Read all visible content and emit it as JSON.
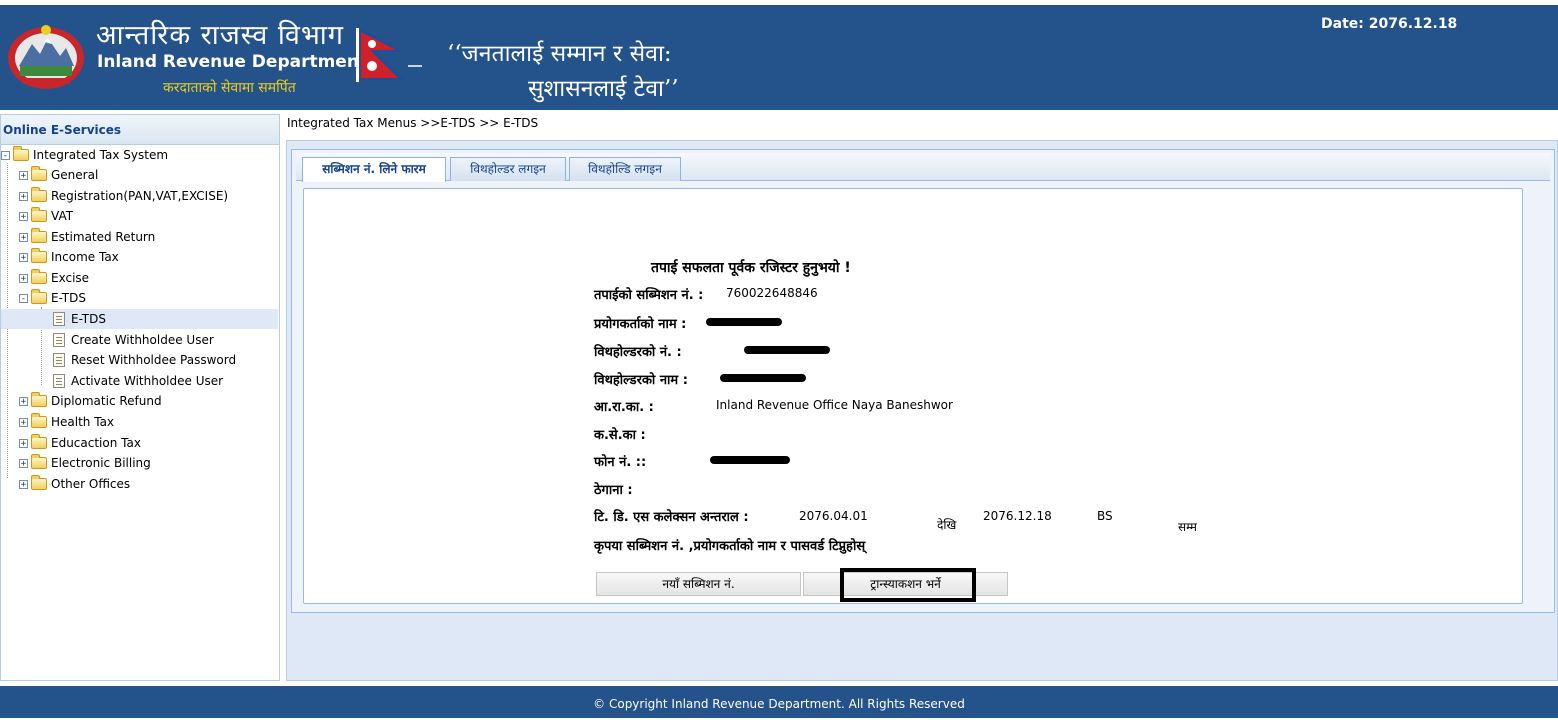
{
  "header": {
    "dept_name_np": "आन्तरिक राजस्व विभाग",
    "dept_name_en": "Inland Revenue Department",
    "motto": "करदाताको सेवामा समर्पित",
    "slogan_line1": "‘‘जनतालाई सम्मान र सेवा:",
    "slogan_line2": "सुशासनलाई टेवा’’",
    "date_label": "Date:",
    "date_value": "2076.12.18",
    "colors": {
      "banner": "#24528a",
      "motto": "#e8d020"
    },
    "icons": [
      "government-emblem-icon",
      "nepal-flag-icon"
    ]
  },
  "sidebar": {
    "title": "Online E-Services",
    "tree": [
      {
        "label": "Integrated Tax System",
        "toggle": "-",
        "icon": "folder-open-icon"
      },
      {
        "label": "General",
        "toggle": "+",
        "icon": "folder-icon"
      },
      {
        "label": "Registration(PAN,VAT,EXCISE)",
        "toggle": "+",
        "icon": "folder-icon"
      },
      {
        "label": "VAT",
        "toggle": "+",
        "icon": "folder-icon"
      },
      {
        "label": "Estimated Return",
        "toggle": "+",
        "icon": "folder-icon"
      },
      {
        "label": "Income Tax",
        "toggle": "+",
        "icon": "folder-icon"
      },
      {
        "label": "Excise",
        "toggle": "+",
        "icon": "folder-icon"
      },
      {
        "label": "E-TDS",
        "toggle": "-",
        "icon": "folder-open-icon"
      },
      {
        "label": "E-TDS",
        "icon": "document-icon",
        "selected": true
      },
      {
        "label": "Create Withholdee User",
        "icon": "document-icon"
      },
      {
        "label": "Reset Withholdee Password",
        "icon": "document-icon"
      },
      {
        "label": "Activate Withholdee User",
        "icon": "document-icon"
      },
      {
        "label": "Diplomatic Refund",
        "toggle": "+",
        "icon": "folder-icon"
      },
      {
        "label": "Health Tax",
        "toggle": "+",
        "icon": "folder-icon"
      },
      {
        "label": "Educaction Tax",
        "toggle": "+",
        "icon": "folder-icon"
      },
      {
        "label": "Electronic Billing",
        "toggle": "+",
        "icon": "folder-icon"
      },
      {
        "label": "Other Offices",
        "toggle": "+",
        "icon": "folder-icon"
      }
    ]
  },
  "breadcrumb": "Integrated Tax Menus >>E-TDS >> E-TDS",
  "tabs": [
    {
      "label": "सब्मिशन नं. लिने फारम",
      "active": true
    },
    {
      "label": "विथहोल्डर लगइन",
      "active": false
    },
    {
      "label": "विथहोल्डि लगइन",
      "active": false
    }
  ],
  "form": {
    "success_message": "तपाई सफलता पूर्वक रजिस्टर हुनुभयो !",
    "submission_label": "तपाईको सब्मिशन नं. :",
    "submission_value": "760022648846",
    "username_label": "प्रयोगकर्ताको नाम :",
    "withholder_no_label": "विथहोल्डरको नं. :",
    "withholder_name_label": "विथहोल्डरको नाम :",
    "iro_label": "आ.रा.का. :",
    "iro_value": "Inland Revenue Office Naya Baneshwor",
    "kaseka_label": "क.से.का :",
    "phone_label": "फोन नं. ::",
    "address_label": "ठेगाना :",
    "tds_period_label": "टि. डि. एस कलेक्सन अन्तराल :",
    "period_from": "2076.04.01",
    "from_suffix": "देखि",
    "period_to": "2076.12.18",
    "calendar": "BS",
    "to_suffix": "सम्म",
    "note": "कृपया सब्मिशन नं. ,प्रयोगकर्ताको नाम र पासवर्ड टिप्नुहोस्"
  },
  "buttons": {
    "new_submission": "नयाँ सब्मिशन नं.",
    "transaction_entry": "ट्रान्स्याकशन भर्ने"
  },
  "footer": "© Copyright Inland Revenue Department. All Rights Reserved"
}
